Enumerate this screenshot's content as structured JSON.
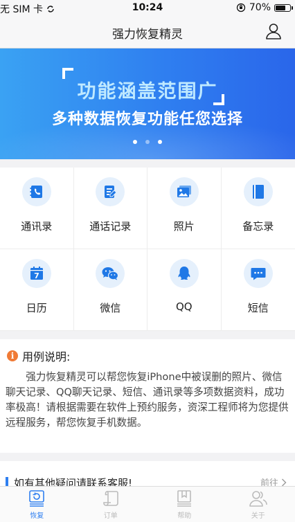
{
  "status": {
    "carrier": "无 SIM 卡",
    "time": "10:24",
    "battery_percent": "70%",
    "battery_level": 0.7
  },
  "nav": {
    "title": "强力恢复精灵"
  },
  "banner": {
    "title": "功能涵盖范围广",
    "subtitle": "多种数据恢复功能任您选择",
    "active_slide": 2,
    "slide_count": 3
  },
  "features": [
    {
      "label": "通讯录",
      "icon": "contacts-icon"
    },
    {
      "label": "通话记录",
      "icon": "call-log-icon"
    },
    {
      "label": "照片",
      "icon": "photos-icon"
    },
    {
      "label": "备忘录",
      "icon": "notes-icon"
    },
    {
      "label": "日历",
      "icon": "calendar-icon"
    },
    {
      "label": "微信",
      "icon": "wechat-icon"
    },
    {
      "label": "QQ",
      "icon": "qq-icon"
    },
    {
      "label": "短信",
      "icon": "sms-icon"
    }
  ],
  "calendar_day": "7",
  "description": {
    "heading": "用例说明:",
    "info_glyph": "i",
    "body": "强力恢复精灵可以帮您恢复iPhone中被误删的照片、微信聊天记录、QQ聊天记录、短信、通讯录等多项数据资料，成功率极高！请根据需要在软件上预约服务，资深工程师将为您提供远程服务，帮您恢复手机数据。"
  },
  "contact": {
    "text": "如有其他疑问请联系客服!",
    "link": "前往"
  },
  "tabs": [
    {
      "label": "恢复",
      "icon": "recover-icon",
      "active": true
    },
    {
      "label": "订单",
      "icon": "orders-icon",
      "active": false
    },
    {
      "label": "帮助",
      "icon": "help-icon",
      "active": false
    },
    {
      "label": "关于",
      "icon": "about-icon",
      "active": false
    }
  ],
  "colors": {
    "accent": "#2f7ff0",
    "icon_bg": "#e5f0fc",
    "info": "#f07a35",
    "tab_inactive": "#bbbbbb"
  }
}
